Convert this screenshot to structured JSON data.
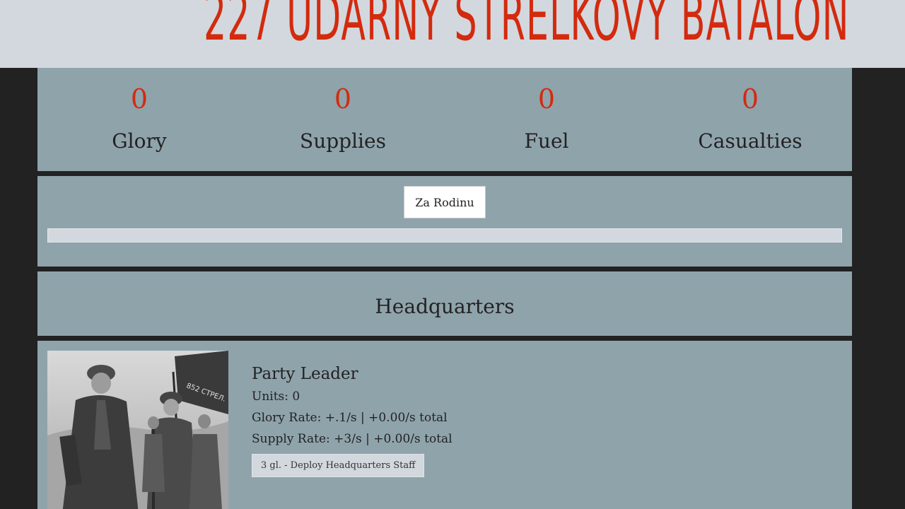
{
  "header": {
    "title": "227 UDARNY STRELKOVY BATALON"
  },
  "resources": [
    {
      "value": "0",
      "label": "Glory"
    },
    {
      "value": "0",
      "label": "Supplies"
    },
    {
      "value": "0",
      "label": "Fuel"
    },
    {
      "value": "0",
      "label": "Casualties"
    }
  ],
  "action": {
    "button_label": "Za Rodinu",
    "progress": 0
  },
  "section": {
    "title": "Headquarters"
  },
  "unit": {
    "name": "Party Leader",
    "units": "Units: 0",
    "glory_rate": "Glory Rate: +.1/s | +0.00/s total",
    "supply_rate": "Supply Rate: +3/s | +0.00/s total",
    "deploy_label": "3 gl. - Deploy Headquarters Staff",
    "photo_banner_text": "852 СТРЕЛ."
  },
  "colors": {
    "accent": "#d42a0e",
    "panel": "#8fa3ab",
    "header_bg": "#d2d8de",
    "background": "#222222"
  }
}
